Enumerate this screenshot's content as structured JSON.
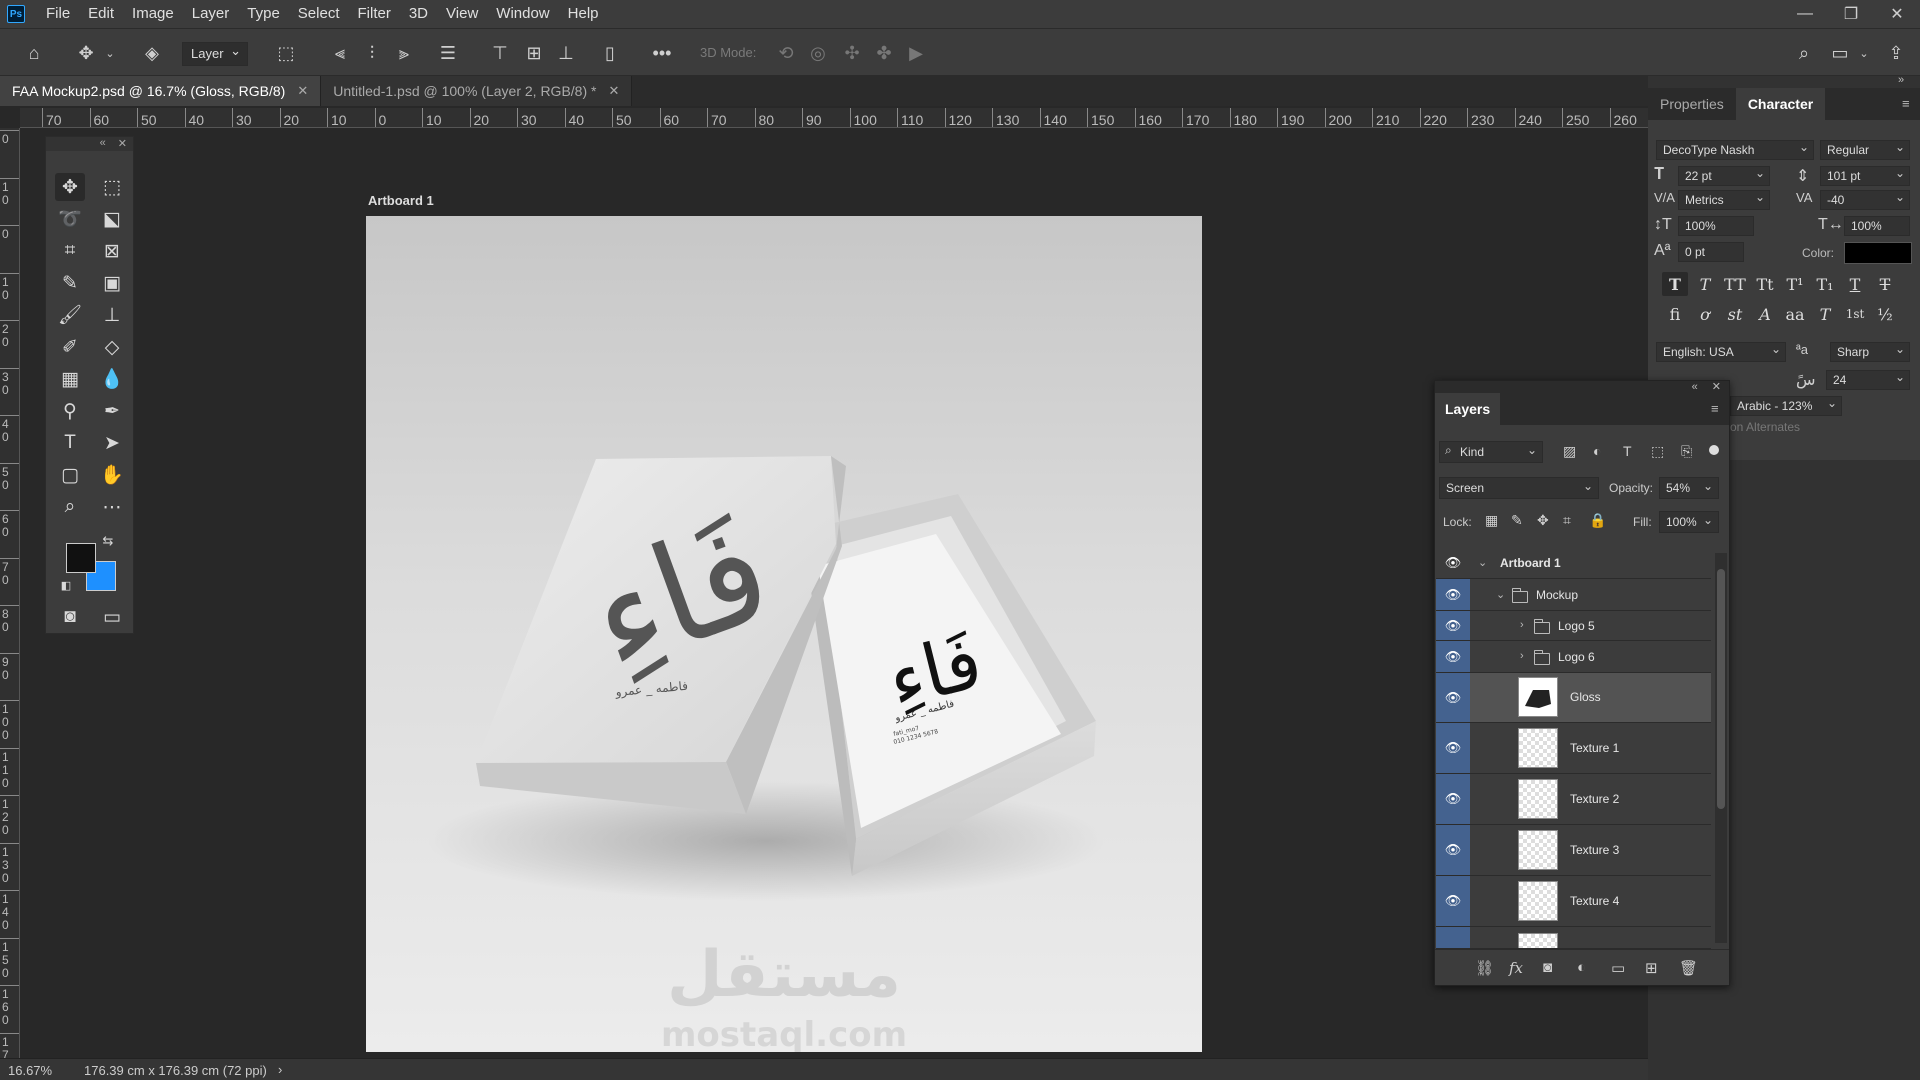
{
  "app": {
    "logo": "Ps"
  },
  "menu": [
    "File",
    "Edit",
    "Image",
    "Layer",
    "Type",
    "Select",
    "Filter",
    "3D",
    "View",
    "Window",
    "Help"
  ],
  "window_controls": {
    "minimize": "—",
    "restore": "❐",
    "close": "✕"
  },
  "options_bar": {
    "auto_select_target": "Layer",
    "mode_3d_label": "3D Mode:"
  },
  "tabs": [
    {
      "label": "FAA Mockup2.psd @ 16.7% (Gloss, RGB/8)",
      "active": true
    },
    {
      "label": "Untitled-1.psd @ 100% (Layer 2, RGB/8) *",
      "active": false
    }
  ],
  "ruler": {
    "h_labels": [
      "70",
      "60",
      "50",
      "40",
      "30",
      "20",
      "10",
      "0",
      "10",
      "20",
      "30",
      "40",
      "50",
      "60",
      "70",
      "80",
      "90",
      "100",
      "110",
      "120",
      "130",
      "140",
      "150",
      "160",
      "170",
      "180",
      "190",
      "200",
      "210",
      "220",
      "230",
      "240",
      "250",
      "260"
    ],
    "v_labels": [
      "0",
      "10",
      "0",
      "10",
      "20",
      "30",
      "40",
      "50",
      "60",
      "70",
      "80",
      "90",
      "100",
      "110",
      "120",
      "130",
      "140",
      "150",
      "160",
      "170"
    ]
  },
  "artboard": {
    "label": "Artboard 1",
    "lid_logo": "فَاءِ",
    "lid_signature": "فاطمه _ عمرو",
    "card_logo": "فَاءِ",
    "card_signature": "فاطمه _ عمرو",
    "card_small_1": "fati_mo7",
    "card_small_2": "010 1234 5678",
    "watermark_ar": "مستقل",
    "watermark_en": "mostaql.com"
  },
  "status": {
    "zoom": "16.67%",
    "doc_size": "176.39 cm x 176.39 cm (72 ppi)"
  },
  "panel_tabs": {
    "properties": "Properties",
    "character": "Character"
  },
  "character": {
    "font_family": "DecoType Naskh",
    "font_style": "Regular",
    "font_size": "22 pt",
    "leading": "101 pt",
    "kerning": "Metrics",
    "tracking": "-40",
    "vertical_scale": "100%",
    "horizontal_scale": "100%",
    "baseline_shift": "0 pt",
    "color_label": "Color:",
    "color_value": "#000000",
    "language": "English: USA",
    "antialias": "Sharp",
    "kashida_value": "24",
    "digits": "Arabic - 123%",
    "alternates": "on Alternates",
    "style_buttons": [
      "T",
      "T",
      "TT",
      "Tt",
      "T¹",
      "T₁",
      "T",
      "T"
    ],
    "ot_buttons": [
      "fi",
      "ơ",
      "st",
      "A",
      "aa",
      "T",
      "1st",
      "½"
    ]
  },
  "layers_panel": {
    "title": "Layers",
    "filter_kind": "Kind",
    "blend_mode": "Screen",
    "opacity_label": "Opacity:",
    "opacity_value": "54%",
    "lock_label": "Lock:",
    "fill_label": "Fill:",
    "fill_value": "100%",
    "layers": [
      {
        "name": "Artboard 1",
        "type": "artboard"
      },
      {
        "name": "Mockup",
        "type": "group"
      },
      {
        "name": "Logo 5",
        "type": "group"
      },
      {
        "name": "Logo 6",
        "type": "group"
      },
      {
        "name": "Gloss",
        "type": "layer",
        "selected": true
      },
      {
        "name": "Texture 1",
        "type": "layer"
      },
      {
        "name": "Texture 2",
        "type": "layer"
      },
      {
        "name": "Texture 3",
        "type": "layer"
      },
      {
        "name": "Texture 4",
        "type": "layer"
      }
    ]
  }
}
